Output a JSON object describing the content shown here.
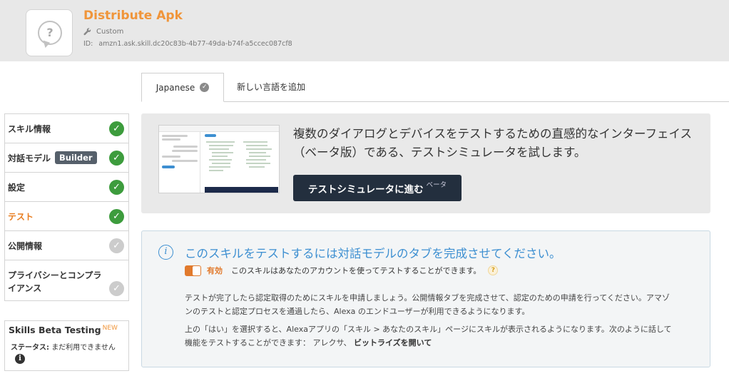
{
  "skill": {
    "title": "Distribute Apk",
    "type_label": "Custom",
    "id_label": "ID:",
    "id_value": "amzn1.ask.skill.dc20c83b-4b77-49da-b74f-a5ccec087cf8",
    "icon_placeholder": "?"
  },
  "tabs": {
    "active_label": "Japanese",
    "add_label": "新しい言語を追加"
  },
  "sidebar": {
    "items": [
      {
        "label": "スキル情報",
        "status": "complete"
      },
      {
        "label": "対話モデル",
        "badge": "Builder",
        "status": "complete"
      },
      {
        "label": "設定",
        "status": "complete"
      },
      {
        "label": "テスト",
        "status": "complete",
        "active": true
      },
      {
        "label": "公開情報",
        "status": "incomplete"
      },
      {
        "label": "プライバシーとコンプライアンス",
        "status": "incomplete"
      }
    ]
  },
  "beta": {
    "title": "Skills Beta Testing",
    "new_badge": "NEW",
    "status_label": "ステータス:",
    "status_value": "まだ利用できません"
  },
  "promo": {
    "text": "複数のダイアログとデバイスをテストするための直感的なインターフェイス（ベータ版）である、テストシミュレータを試します。",
    "button_label": "テストシミュレータに進む",
    "button_beta": "ベータ"
  },
  "info": {
    "heading": "このスキルをテストするには対話モデルのタブを完成させてください。",
    "toggle_label": "有効",
    "toggle_state": "on",
    "toggle_desc": "このスキルはあなたのアカウントを使ってテストすることができます。",
    "help": "?",
    "para1": "テストが完了したら認定取得のためにスキルを申請しましょう。公開情報タブを完成させて、認定のための申請を行ってください。アマゾンのテストと認定プロセスを通過したら、Alexa のエンドユーザーが利用できるようになります。",
    "para2_prefix": "上の「はい」を選択すると、Alexaアプリの「スキル > あなたのスキル」ページにスキルが表示されるようになります。次のように話して機能をテストすることができます： アレクサ、",
    "para2_bold": "ビットライズを開いて"
  },
  "colors": {
    "accent_orange": "#f0953a",
    "complete_green": "#3d9c3d",
    "info_blue": "#3d8fd1",
    "button_dark": "#232f3e"
  }
}
